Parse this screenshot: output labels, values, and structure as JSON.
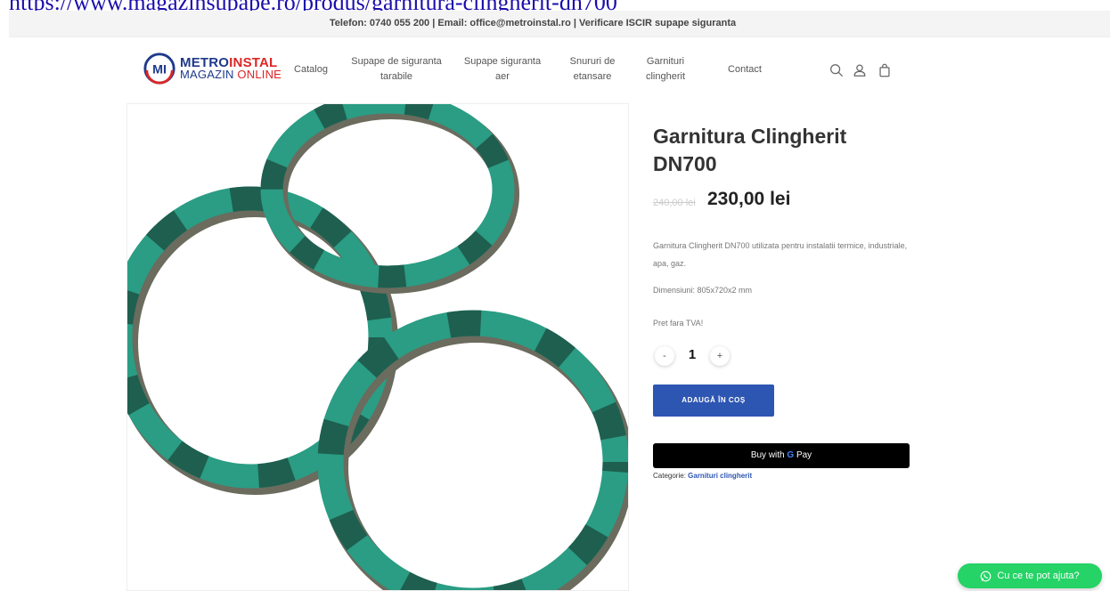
{
  "url_line": "https://www.magazinsupape.ro/produs/garnitura-clingherit-dn700",
  "topbar": {
    "text": "Telefon: 0740 055 200 | Email: office@metroinstal.ro | Verificare ISCIR supape siguranta"
  },
  "logo": {
    "badge": "MI",
    "line1_a": "METRO",
    "line1_b": "INSTAL",
    "line2_a": "MAGAZIN",
    "line2_b": " ONLINE"
  },
  "nav": {
    "catalog": "Catalog",
    "supape_tarabile_1": "Supape de siguranta",
    "supape_tarabile_2": "tarabile",
    "supape_aer_1": "Supape siguranta",
    "supape_aer_2": "aer",
    "snururi_1": "Snururi de",
    "snururi_2": "etansare",
    "garnituri_1": "Garnituri",
    "garnituri_2": "clingherit",
    "contact": "Contact"
  },
  "icons": {
    "search": "search-icon",
    "account": "user-icon",
    "cart": "shopping-bag-icon"
  },
  "product": {
    "title_line1": "Garnitura Clingherit",
    "title_line2": "DN700",
    "old_price": "240,00 lei",
    "new_price": "230,00 lei",
    "description": "Garnitura Clingherit DN700  utilizata pentru instalatii termice, industriale, apa, gaz.",
    "dimensions": "Dimensiuni: 805x720x2 mm",
    "vat_note": "Pret fara TVA!",
    "quantity": "1",
    "qty_minus": "-",
    "qty_plus": "+",
    "add_to_cart": "ADAUGĂ ÎN COȘ",
    "gpay_prefix": "Buy with ",
    "gpay_g": "G",
    "gpay_suffix": " Pay",
    "category_label": "Categorie: ",
    "category_link": "Garnituri clingherit"
  },
  "chat": {
    "label": "Cu ce te pot ajuta?"
  },
  "colors": {
    "brand_navy": "#1e3a8a",
    "brand_red": "#dc2626",
    "button_blue": "#2d55b2",
    "whatsapp_green": "#25d366",
    "gasket_teal": "#2a9d84"
  }
}
